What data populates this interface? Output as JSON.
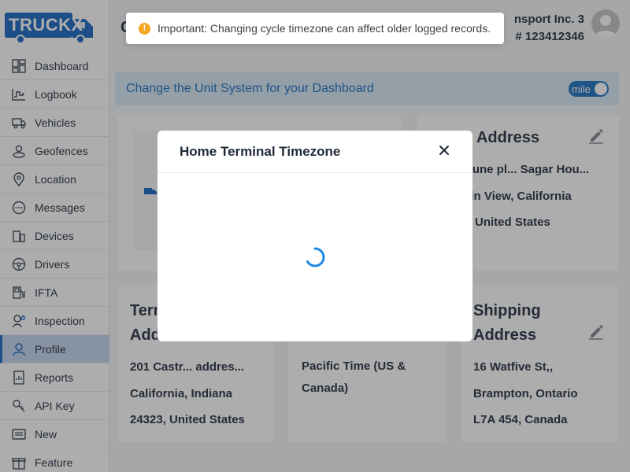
{
  "app": {
    "logo_text": "TRUCKX"
  },
  "sidebar": {
    "items": [
      {
        "label": "Dashboard",
        "icon": "dashboard-icon"
      },
      {
        "label": "Logbook",
        "icon": "logbook-icon"
      },
      {
        "label": "Vehicles",
        "icon": "truck-icon"
      },
      {
        "label": "Geofences",
        "icon": "geofence-icon"
      },
      {
        "label": "Location",
        "icon": "location-pin-icon"
      },
      {
        "label": "Messages",
        "icon": "chat-icon"
      },
      {
        "label": "Devices",
        "icon": "devices-icon"
      },
      {
        "label": "Drivers",
        "icon": "steering-wheel-icon"
      },
      {
        "label": "IFTA",
        "icon": "fuel-pump-icon"
      },
      {
        "label": "Inspection",
        "icon": "inspection-icon"
      },
      {
        "label": "Profile",
        "icon": "user-icon"
      },
      {
        "label": "Reports",
        "icon": "reports-icon"
      },
      {
        "label": "API Key",
        "icon": "key-icon"
      },
      {
        "label": "New",
        "icon": "new-icon"
      },
      {
        "label": "Feature",
        "icon": "gift-icon"
      }
    ],
    "active": "Profile"
  },
  "header": {
    "title_initial": "C",
    "company_name": "nsport Inc. 3",
    "company_id": "# 123412346"
  },
  "toast": {
    "icon": "warning-icon",
    "message": "Important: Changing cycle timezone can affect older logged records."
  },
  "unit_banner": {
    "text": "Change the Unit System for your Dashboard",
    "toggle_label": "mile"
  },
  "cards": {
    "address": {
      "title": "e Address",
      "lines": [
        "rtune pl... Sagar Hou...",
        "ain View, California",
        "United States"
      ]
    },
    "terminal": {
      "title_line1": "Term",
      "title_line2": "Add",
      "lines": [
        "201 Castr... addres...",
        "California, Indiana",
        "24323, United States"
      ]
    },
    "timezone": {
      "lines": [
        "Pacific Time (US &",
        "Canada)"
      ]
    },
    "shipping": {
      "title_line1": "Shipping",
      "title_line2": "Address",
      "lines": [
        "16 Watfive St,,",
        "Brampton, Ontario",
        "L7A 454, Canada"
      ]
    }
  },
  "modal": {
    "title": "Home Terminal Timezone",
    "state": "loading"
  },
  "colors": {
    "brand_blue": "#2c74c9",
    "sidebar_active_bg": "#c7d9ef",
    "banner_bg": "#dbeaf7",
    "toast_warning": "#f5a623",
    "spinner": "#1e88e5"
  }
}
